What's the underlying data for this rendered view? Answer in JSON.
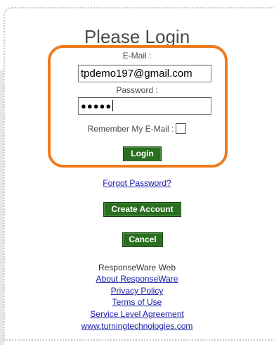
{
  "login": {
    "title": "Please Login",
    "email_label": "E-Mail :",
    "email_value": "tpdemo197@gmail.com",
    "password_label": "Password :",
    "password_mask": "●●●●●",
    "remember_label": "Remember My E-Mail :",
    "remember_checked": false,
    "login_button": "Login"
  },
  "links": {
    "forgot_password": "Forgot Password?"
  },
  "actions": {
    "create_account": "Create Account",
    "cancel": "Cancel"
  },
  "footer": {
    "product": "ResponseWare Web",
    "about": "About ResponseWare",
    "privacy": "Privacy Policy",
    "terms": "Terms of Use",
    "sla": "Service Level Agreement",
    "website": "www.turningtechnologies.com"
  },
  "colors": {
    "highlight": "#ee7b1f",
    "button_bg": "#2a6e1f",
    "link": "#1a1aa8"
  }
}
